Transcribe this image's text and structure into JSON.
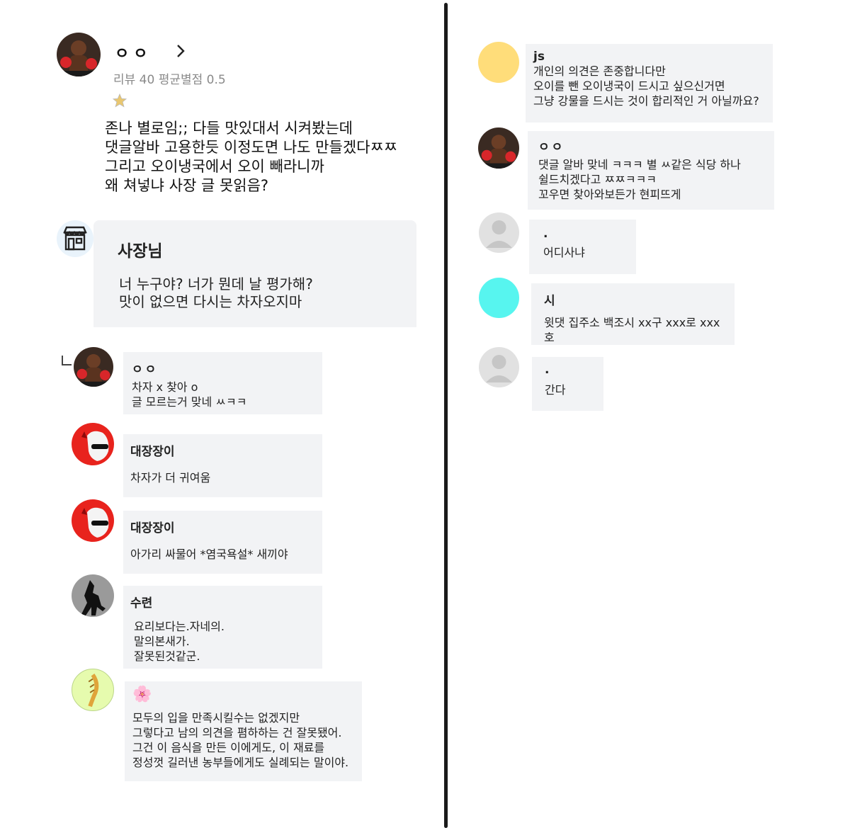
{
  "review": {
    "author": "ㅇㅇ",
    "meta": "리뷰 40  평균별점 0.5",
    "star_icon": "star-icon",
    "body": "존나 별로임;; 다들 맛있대서 시켜봤는데\n댓글알바 고용한듯 이정도면 나도 만들겠다ㅉㅉ\n그리고 오이냉국에서 오이 빼라니까\n왜 쳐넣냐 사장 글 못읽음?"
  },
  "owner_reply": {
    "name": "사장님",
    "text": "너 누구야? 너가 뭔데 날 평가해?\n맛이 없으면 다시는 차자오지마"
  },
  "left_comments": [
    {
      "name": "ㅇㅇ",
      "text": "차자 x 찾아 o\n글 모르는거 맞네 ㅆㅋㅋ"
    },
    {
      "name": "대장장이",
      "text": "차자가 더 귀여움"
    },
    {
      "name": "대장장이",
      "text": "아가리 싸물어 *염국욕설* 새끼야"
    },
    {
      "name": "수련",
      "text": "요리보다는.자네의.\n말의본새가.\n잘못된것같군."
    },
    {
      "name": "🌸",
      "text": "모두의 입을 만족시킬수는 없겠지만\n그렇다고 남의 의견을 폄하하는 건 잘못됐어.\n그건 이 음식을 만든 이에게도, 이 재료를\n정성껏 길러낸 농부들에게도 실례되는 말이야."
    }
  ],
  "right_comments": [
    {
      "name": "js",
      "text": "개인의 의견은 존중합니다만\n오이를 뺀 오이냉국이 드시고 싶으신거면\n그냥 강물을 드시는 것이 합리적인 거 아닐까요?"
    },
    {
      "name": "ㅇㅇ",
      "text": "댓글 알바 맞네 ㅋㅋㅋ 별 ㅆ같은 식당 하나\n쉴드치겠다고 ㅉㅉㅋㅋㅋ\n꼬우면 찾아와보든가 현피뜨게"
    },
    {
      "name": ".",
      "text": "어디사냐"
    },
    {
      "name": "시",
      "text": "윗댓 집주소 백조시 xx구 xxx로 xxx호"
    },
    {
      "name": ".",
      "text": "간다"
    }
  ],
  "colors": {
    "bubble_bg": "#f2f3f5",
    "meta_gray": "#8a8a8a",
    "avatar_yellow": "#ffdd7a",
    "avatar_cyan": "#57f5ef",
    "avatar_default": "#e1e1e1",
    "devil_red": "#e8231d"
  }
}
